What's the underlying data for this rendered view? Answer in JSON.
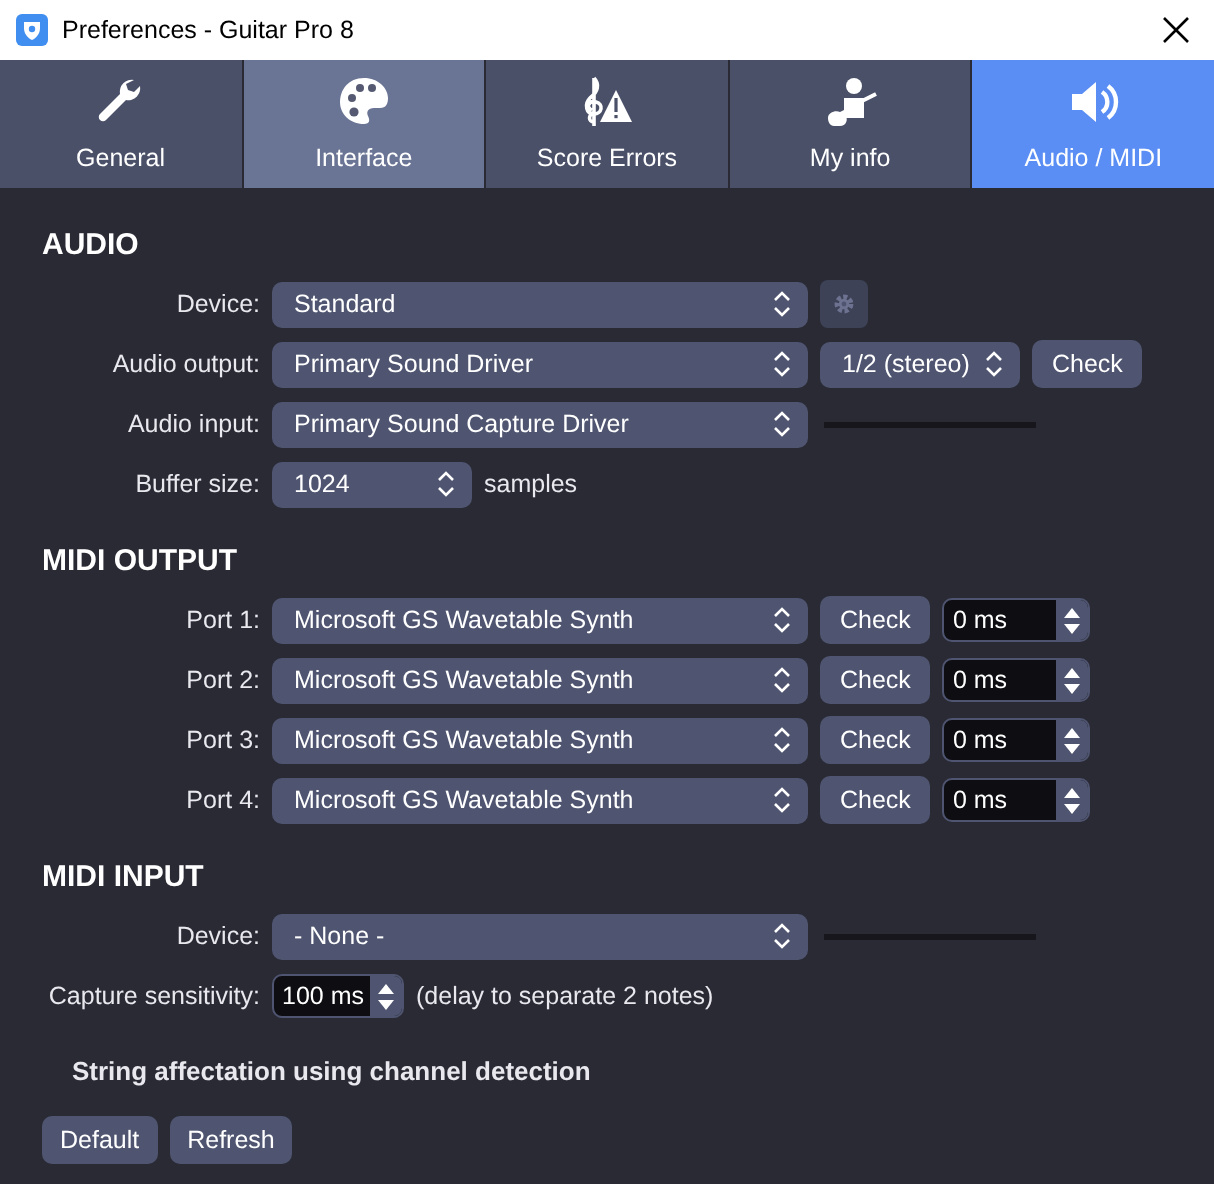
{
  "window": {
    "title": "Preferences - Guitar Pro 8"
  },
  "tabs": [
    {
      "label": "General",
      "selected": false,
      "hovered": false
    },
    {
      "label": "Interface",
      "selected": false,
      "hovered": true
    },
    {
      "label": "Score Errors",
      "selected": false,
      "hovered": false
    },
    {
      "label": "My info",
      "selected": false,
      "hovered": false
    },
    {
      "label": "Audio / MIDI",
      "selected": true,
      "hovered": false
    }
  ],
  "sections": [
    {
      "heading": "AUDIO",
      "rows": [
        {
          "label": "Device:",
          "controls": [
            {
              "kind": "select",
              "value": "Standard"
            },
            {
              "kind": "gear",
              "disabled": true
            }
          ]
        },
        {
          "label": "Audio output:",
          "controls": [
            {
              "kind": "select",
              "value": "Primary Sound Driver"
            },
            {
              "kind": "small_select",
              "value": "1/2 (stereo)"
            },
            {
              "kind": "button",
              "text": "Check"
            }
          ]
        },
        {
          "label": "Audio input:",
          "controls": [
            {
              "kind": "select",
              "value": "Primary Sound Capture Driver"
            },
            {
              "kind": "meter",
              "level": 0
            }
          ]
        },
        {
          "label": "Buffer size:",
          "controls": [
            {
              "kind": "short_select",
              "value": "1024"
            },
            {
              "kind": "text",
              "text": "samples"
            }
          ]
        }
      ]
    },
    {
      "heading": "MIDI OUTPUT",
      "rows": [
        {
          "label": "Port 1:",
          "controls": [
            {
              "kind": "select",
              "value": "Microsoft GS Wavetable Synth"
            },
            {
              "kind": "button",
              "text": "Check"
            },
            {
              "kind": "spin",
              "value": "0 ms"
            }
          ]
        },
        {
          "label": "Port 2:",
          "controls": [
            {
              "kind": "select",
              "value": "Microsoft GS Wavetable Synth"
            },
            {
              "kind": "button",
              "text": "Check"
            },
            {
              "kind": "spin",
              "value": "0 ms"
            }
          ]
        },
        {
          "label": "Port 3:",
          "controls": [
            {
              "kind": "select",
              "value": "Microsoft GS Wavetable Synth"
            },
            {
              "kind": "button",
              "text": "Check"
            },
            {
              "kind": "spin",
              "value": "0 ms"
            }
          ]
        },
        {
          "label": "Port 4:",
          "controls": [
            {
              "kind": "select",
              "value": "Microsoft GS Wavetable Synth"
            },
            {
              "kind": "button",
              "text": "Check"
            },
            {
              "kind": "spin",
              "value": "0 ms"
            }
          ]
        }
      ]
    },
    {
      "heading": "MIDI INPUT",
      "rows": [
        {
          "label": "Device:",
          "controls": [
            {
              "kind": "select",
              "value": "- None -"
            },
            {
              "kind": "meter",
              "level": 0
            }
          ]
        },
        {
          "label": "Capture sensitivity:",
          "controls": [
            {
              "kind": "short_spin",
              "value": "100 ms"
            },
            {
              "kind": "text",
              "text": "(delay to separate 2 notes)"
            }
          ]
        }
      ]
    }
  ],
  "note": "String affectation using channel detection",
  "buttons": [
    "Default",
    "Refresh"
  ]
}
